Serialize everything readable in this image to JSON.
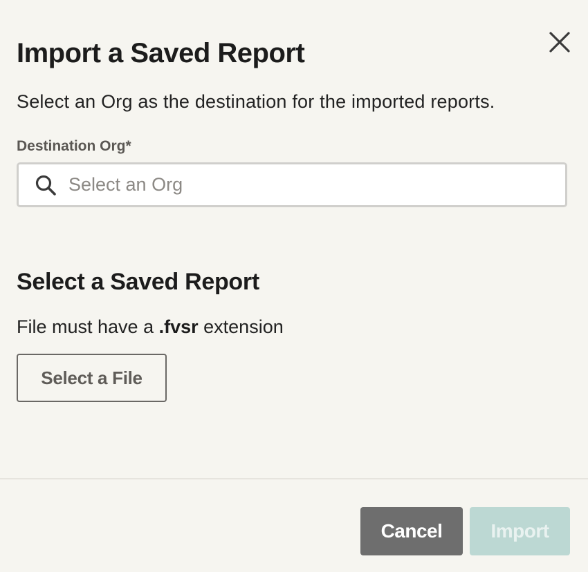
{
  "dialog": {
    "title": "Import a Saved Report",
    "subtitle": "Select an Org as the destination for the imported reports.",
    "close_icon": "close-icon"
  },
  "destination": {
    "label": "Destination Org*",
    "search_icon": "search-icon",
    "placeholder": "Select an Org",
    "value": ""
  },
  "report_section": {
    "title": "Select a Saved Report",
    "hint_prefix": "File must have a ",
    "hint_extension": ".fvsr",
    "hint_suffix": " extension",
    "select_file_label": "Select a File"
  },
  "footer": {
    "cancel_label": "Cancel",
    "import_label": "Import",
    "import_disabled": true
  },
  "colors": {
    "background": "#f6f5f0",
    "cancel_button": "#6e6e6e",
    "import_button_disabled": "#bcd8d3"
  }
}
